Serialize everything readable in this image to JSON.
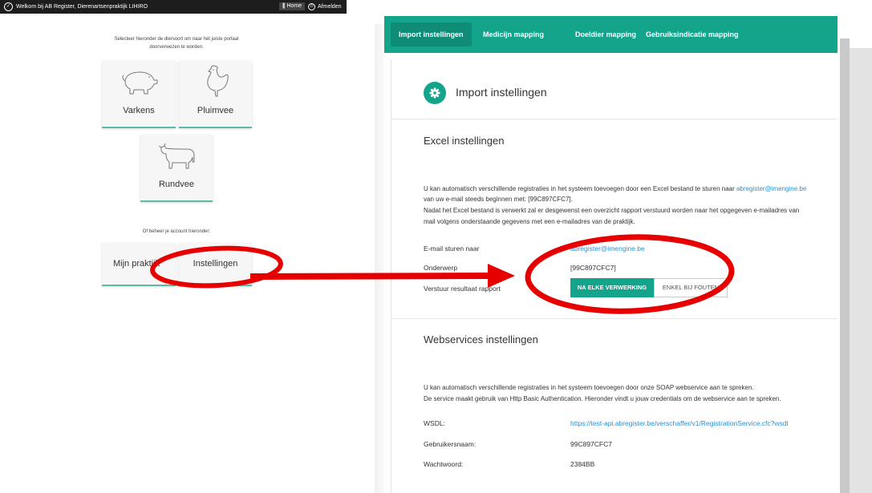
{
  "left": {
    "topbar": {
      "welcome": "Welkom bij AB Register, Dierenartsenpraktijk LIHIRO",
      "home": "Home",
      "logout": "Afmelden"
    },
    "intro": "Selecteer hieronder de diersoort om naar het juiste portaal doorverwezen te worden:",
    "cards": {
      "pigs": "Varkens",
      "poultry": "Pluimvee",
      "cattle": "Rundvee"
    },
    "or_text": "Of beheer je account hieronder:",
    "account": {
      "my_practice": "Mijn praktijk",
      "settings": "Instellingen"
    }
  },
  "right": {
    "tabs": [
      "Import instellingen",
      "Medicijn mapping",
      "Doeldier mapping",
      "Gebruiksindicatie mapping"
    ],
    "page_title": "Import instellingen",
    "excel": {
      "heading": "Excel instellingen",
      "p1a": "U kan automatisch verschillende registraties in het systeem toevoegen door een Excel bestand te sturen naar ",
      "p1_link": "abregister@imengine.be",
      "p2": "van uw e-mail steeds beginnen met: [99C897CFC7].",
      "p3": "Nadat het Excel bestand is verwerkt zal er desgewenst een overzicht rapport verstuurd worden naar het opgegeven e-mailadres van",
      "p4": "mail volgens onderstaande gegevens met een e-mailadres van de praktijk.",
      "email_label": "E-mail sturen naar",
      "email_value": "abregister@imengine.be",
      "subject_label": "Onderwerp",
      "subject_value": "[99C897CFC7]",
      "report_label": "Verstuur resultaat rapport",
      "opt_on": "NA ELKE VERWERKING",
      "opt_off": "ENKEL BIJ FOUTEN"
    },
    "webservices": {
      "heading": "Webservices instellingen",
      "p1": "U kan automatisch verschillende registraties in het systeem toevoegen door onze SOAP webservice aan te spreken.",
      "p2": "De service maakt gebruik van Http Basic Authentication. Hieronder vindt u jouw credentials om de webservice aan te spreken.",
      "wsdl_label": "WSDL:",
      "wsdl_value": "https://test-api.abregister.be/verschaffer/v1/RegistrationService.cfc?wsdl",
      "user_label": "Gebruikersnaam:",
      "user_value": "99C897CFC7",
      "pass_label": "Wachtwoord:",
      "pass_value": "2384BB"
    }
  },
  "colors": {
    "teal": "#14a48c",
    "annotation": "#e60000",
    "link": "#2a90d0"
  }
}
